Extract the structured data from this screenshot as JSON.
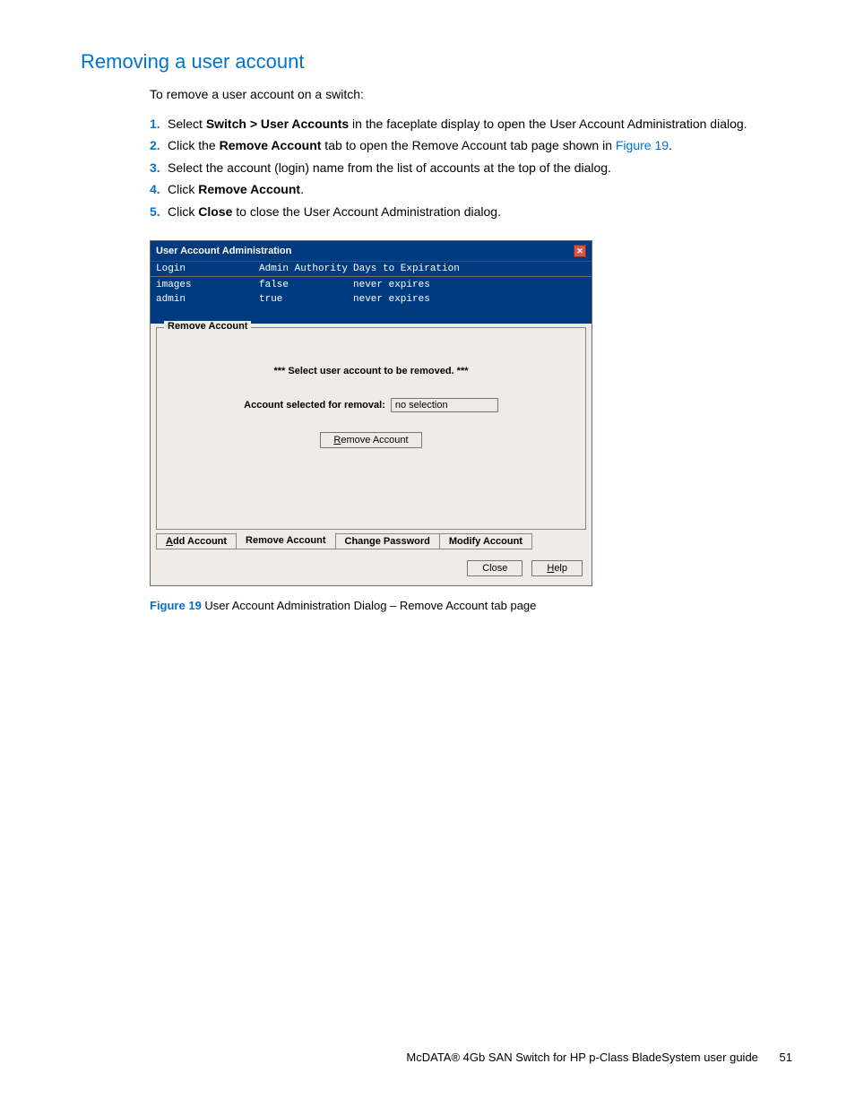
{
  "heading": "Removing a user account",
  "intro": "To remove a user account on a switch:",
  "steps": [
    {
      "pre": "Select ",
      "bold": "Switch > User Accounts",
      "post": " in the faceplate display to open the User Account Administration dialog."
    },
    {
      "pre": "Click the ",
      "bold": "Remove Account",
      "post": " tab to open the Remove Account tab page shown in ",
      "link": "Figure 19",
      "post2": "."
    },
    {
      "pre": "Select the account (login) name from the list of accounts at the top of the dialog.",
      "bold": "",
      "post": ""
    },
    {
      "pre": "Click ",
      "bold": "Remove Account",
      "post": "."
    },
    {
      "pre": "Click ",
      "bold": "Close",
      "post": " to close the User Account Administration dialog."
    }
  ],
  "dialog": {
    "title": "User Account Administration",
    "columns": {
      "login": "Login",
      "admin": "Admin Authority",
      "days": "Days to Expiration"
    },
    "rows": [
      {
        "login": "images",
        "admin": "false",
        "days": "never expires"
      },
      {
        "login": "admin",
        "admin": "true",
        "days": "never expires"
      }
    ],
    "activeTabLabel": "Remove Account",
    "instruction": "*** Select user account to be removed. ***",
    "fieldLabel": "Account selected for removal:",
    "fieldValue": "no selection",
    "removeBtn": "Remove Account",
    "tabs": {
      "add": "Add Account",
      "remove": "Remove Account",
      "change": "Change Password",
      "modify": "Modify Account"
    },
    "closeBtn": "Close",
    "helpBtn": "Help"
  },
  "caption": {
    "label": "Figure 19",
    "text": " User Account Administration Dialog – Remove Account tab page"
  },
  "footer": {
    "text": "McDATA® 4Gb SAN Switch for HP p-Class BladeSystem user guide",
    "page": "51"
  }
}
